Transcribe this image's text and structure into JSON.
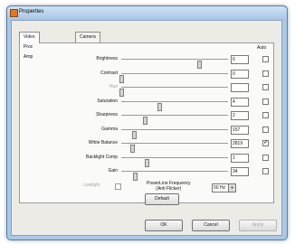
{
  "window": {
    "title": "Properties"
  },
  "tabs": [
    {
      "label": "Video Proc Amp",
      "active": true
    },
    {
      "label": "Camera Control",
      "active": false
    }
  ],
  "auto_header": "Auto",
  "properties": [
    {
      "label": "Brightness",
      "value": "6",
      "slider": 0.74,
      "enabled": true,
      "auto": false
    },
    {
      "label": "Contrast",
      "value": "0",
      "slider": 0.0,
      "enabled": true,
      "auto": false
    },
    {
      "label": "Hue",
      "value": "",
      "slider": 0.0,
      "enabled": false,
      "auto": false
    },
    {
      "label": "Saturation",
      "value": "4",
      "slider": 0.36,
      "enabled": true,
      "auto": false
    },
    {
      "label": "Sharpness",
      "value": "2",
      "slider": 0.22,
      "enabled": true,
      "auto": false
    },
    {
      "label": "Gamma",
      "value": "157",
      "slider": 0.12,
      "enabled": true,
      "auto": false
    },
    {
      "label": "White Balance",
      "value": "2819",
      "slider": 0.1,
      "enabled": true,
      "auto": true
    },
    {
      "label": "Backlight Comp",
      "value": "1",
      "slider": 0.24,
      "enabled": true,
      "auto": false
    },
    {
      "label": "Gain",
      "value": "34",
      "slider": 0.13,
      "enabled": true,
      "auto": false
    }
  ],
  "lowlight": {
    "label": "Lowlight",
    "checked": false
  },
  "powerline": {
    "label_line1": "PowerLine Frequency",
    "label_line2": "(Anti Flicker)",
    "value": "50 Hz"
  },
  "buttons": {
    "default": "Default",
    "ok": "OK",
    "cancel": "Cancel",
    "apply": "Apply"
  }
}
